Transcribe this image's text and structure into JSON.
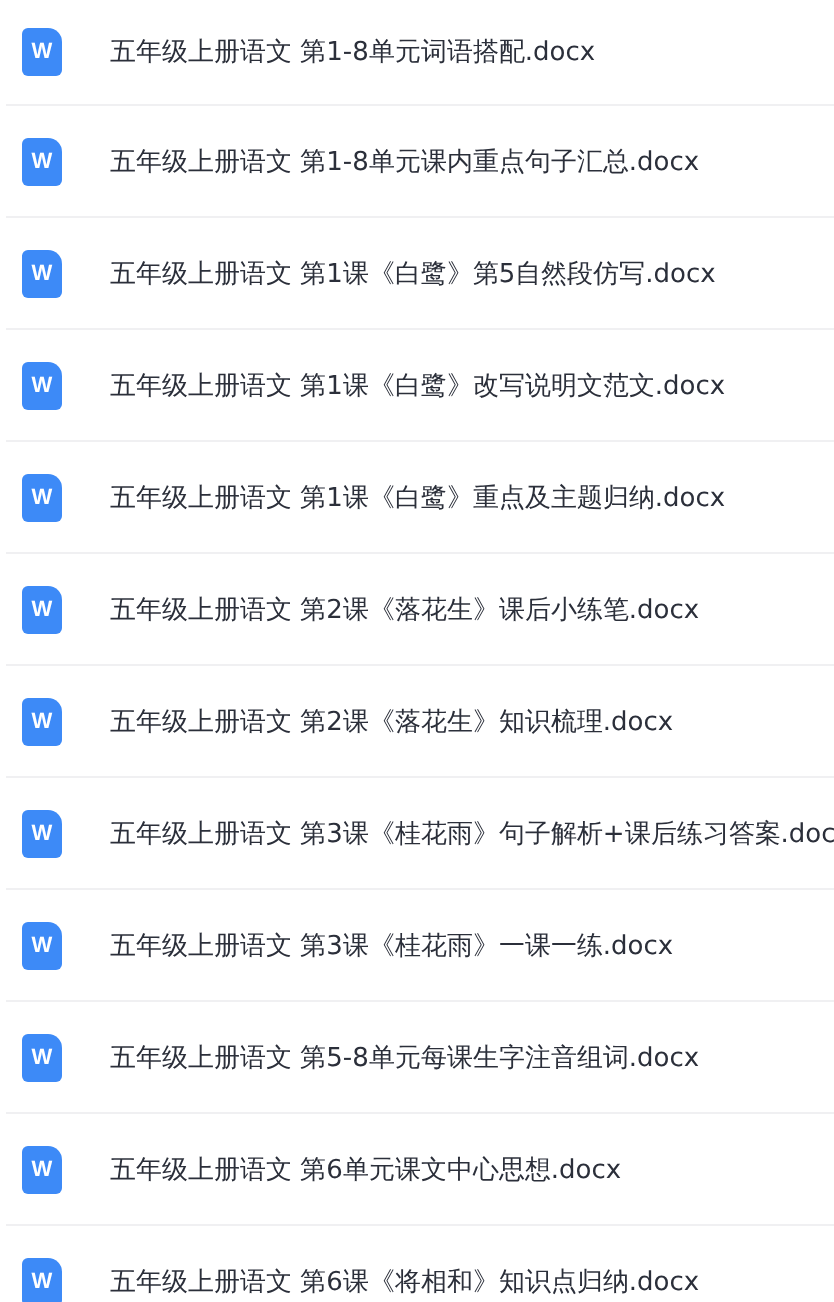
{
  "files": [
    {
      "name": "五年级上册语文 第1-8单元词语搭配.docx",
      "icon_label": "W"
    },
    {
      "name": "五年级上册语文 第1-8单元课内重点句子汇总.docx",
      "icon_label": "W"
    },
    {
      "name": "五年级上册语文 第1课《白鹭》第5自然段仿写.docx",
      "icon_label": "W"
    },
    {
      "name": "五年级上册语文 第1课《白鹭》改写说明文范文.docx",
      "icon_label": "W"
    },
    {
      "name": "五年级上册语文 第1课《白鹭》重点及主题归纳.docx",
      "icon_label": "W"
    },
    {
      "name": "五年级上册语文 第2课《落花生》课后小练笔.docx",
      "icon_label": "W"
    },
    {
      "name": "五年级上册语文 第2课《落花生》知识梳理.docx",
      "icon_label": "W"
    },
    {
      "name": "五年级上册语文 第3课《桂花雨》句子解析+课后练习答案.doc",
      "icon_label": "W"
    },
    {
      "name": "五年级上册语文 第3课《桂花雨》一课一练.docx",
      "icon_label": "W"
    },
    {
      "name": "五年级上册语文 第5-8单元每课生字注音组词.docx",
      "icon_label": "W"
    },
    {
      "name": "五年级上册语文 第6单元课文中心思想.docx",
      "icon_label": "W"
    },
    {
      "name": "五年级上册语文 第6课《将相和》知识点归纳.docx",
      "icon_label": "W"
    }
  ]
}
